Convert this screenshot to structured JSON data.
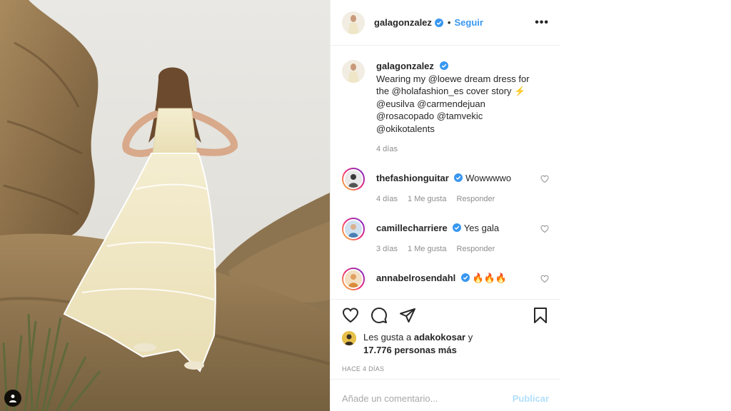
{
  "post": {
    "author": "galagonzalez",
    "separator": "•",
    "follow_label": "Seguir",
    "more_label": "•••",
    "caption_lines": [
      "Wearing my @loewe dream dress for",
      "the @holafashion_es cover story ⚡",
      "@eusilva @carmendejuan",
      "@rosacopado @tamvekic",
      "@okikotalents"
    ],
    "caption_age": "4 días"
  },
  "comments": [
    {
      "user": "thefashionguitar",
      "text": "Wowwwwo",
      "age": "4 días",
      "likes": "1 Me gusta",
      "reply": "Responder"
    },
    {
      "user": "camillecharriere",
      "text": "Yes gala",
      "age": "3 días",
      "likes": "1 Me gusta",
      "reply": "Responder"
    },
    {
      "user": "annabelrosendahl",
      "text": "🔥🔥🔥"
    }
  ],
  "likes": {
    "prefix": "Les gusta a",
    "user": "adakokosar",
    "joiner": "y",
    "count": "17.776 personas más"
  },
  "time_ago": "HACE 4 DÍAS",
  "comment_box": {
    "placeholder": "Añade un comentario...",
    "publish_label": "Publicar"
  },
  "icons": {
    "verified": "verified-badge-icon",
    "like": "heart-icon",
    "comment": "comment-bubble-icon",
    "share": "paper-plane-icon",
    "save": "bookmark-icon",
    "user_tag": "person-icon"
  },
  "colors": {
    "link": "#3897f0",
    "publish_disabled": "#b2dffc",
    "muted": "#8e8e8e",
    "text": "#262626"
  }
}
